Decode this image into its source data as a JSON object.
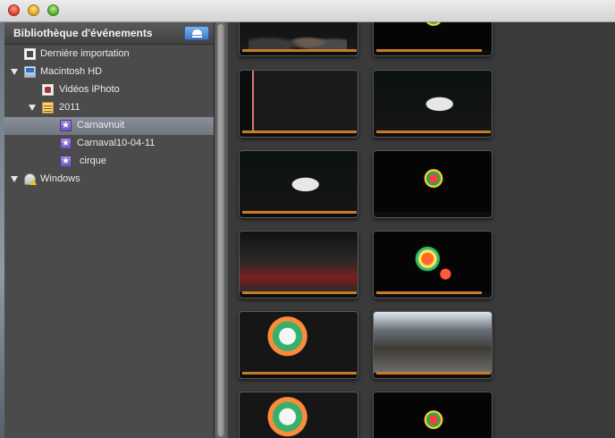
{
  "window": {
    "controls": [
      "close",
      "minimize",
      "zoom"
    ]
  },
  "sidebar": {
    "title": "Bibliothèque d'événements",
    "items": [
      {
        "label": "Dernière importation",
        "icon": "last-import-icon"
      },
      {
        "label": "Macintosh HD",
        "icon": "hard-drive-icon",
        "expanded": true
      },
      {
        "label": "Vidéos iPhoto",
        "icon": "iphoto-icon"
      },
      {
        "label": "2011",
        "icon": "calendar-icon",
        "expanded": true
      },
      {
        "label": "Carnavnuit",
        "icon": "event-star-icon",
        "selected": true
      },
      {
        "label": "Carnaval10-04-11",
        "icon": "event-star-icon"
      },
      {
        "label": "cirque",
        "icon": "event-star-icon"
      },
      {
        "label": "Windows",
        "icon": "network-drive-icon",
        "expanded": true
      }
    ]
  },
  "colors": {
    "selection": "#7b828b",
    "clip_bar": "#c77b2a",
    "background": "#3a3a3a"
  },
  "clips_count_visible": 12
}
